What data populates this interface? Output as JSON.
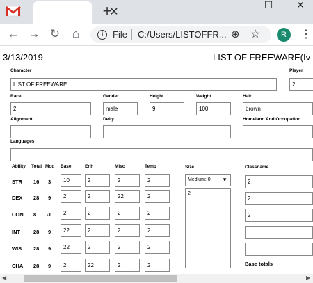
{
  "browser": {
    "tab_close": "✕",
    "new_tab": "+",
    "win_min": "—",
    "win_max": "☐",
    "win_close": "✕",
    "back": "←",
    "forward": "→",
    "reload": "↻",
    "home": "⌂",
    "info": "i",
    "scheme_label": "File",
    "url": "C:/Users/LISTOFFR...",
    "zoom": "⊕",
    "star": "☆",
    "avatar_letter": "R",
    "menu": "⋮",
    "gmail_color": "#d93025",
    "avatar_color": "#1a8a6e"
  },
  "sheet": {
    "date": "3/13/2019",
    "title": "LIST OF FREEWARE(Iv",
    "labels": {
      "character": "Character",
      "player": "Player",
      "race": "Race",
      "gender": "Gender",
      "height": "Height",
      "weight": "Weight",
      "hair": "Hair",
      "alignment": "Alignment",
      "deity": "Deity",
      "homeland": "Homeland And Occupation",
      "languages": "Languages",
      "size": "Size",
      "classname": "Classname",
      "base_totals": "Base totals"
    },
    "values": {
      "character": "LIST OF FREEWARE",
      "player": "2",
      "race": "2",
      "gender": "male",
      "height": "9",
      "weight": "100",
      "hair": "brown",
      "alignment": "",
      "deity": "",
      "homeland": "",
      "languages": ""
    },
    "ability_headers": [
      "Ability",
      "Total",
      "Mod",
      "Base",
      "Enh",
      "Misc",
      "Temp"
    ],
    "abilities": [
      {
        "name": "STR",
        "total": "16",
        "mod": "3",
        "base": "10",
        "enh": "2",
        "misc": "2",
        "temp": "2"
      },
      {
        "name": "DEX",
        "total": "28",
        "mod": "9",
        "base": "2",
        "enh": "2",
        "misc": "22",
        "temp": "2"
      },
      {
        "name": "CON",
        "total": "8",
        "mod": "-1",
        "base": "2",
        "enh": "2",
        "misc": "2",
        "temp": "2"
      },
      {
        "name": "INT",
        "total": "28",
        "mod": "9",
        "base": "22",
        "enh": "2",
        "misc": "2",
        "temp": "2"
      },
      {
        "name": "WIS",
        "total": "28",
        "mod": "9",
        "base": "22",
        "enh": "2",
        "misc": "2",
        "temp": "2"
      },
      {
        "name": "CHA",
        "total": "28",
        "mod": "9",
        "base": "2",
        "enh": "22",
        "misc": "2",
        "temp": "2"
      }
    ],
    "size_selected": "Medium: 0",
    "size_arrow": "▼",
    "size_list_value": "2",
    "classnames": [
      "2",
      "2",
      "2",
      "",
      ""
    ]
  },
  "scrollbar": {
    "left_arrow": "◀",
    "right_arrow": "▶"
  }
}
